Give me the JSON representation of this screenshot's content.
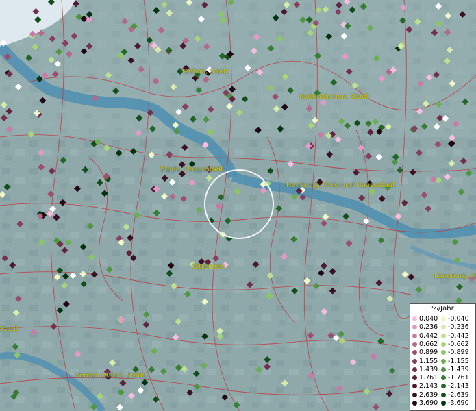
{
  "map": {
    "cities": [
      {
        "name": "Itzehoe, Stadt"
      },
      {
        "name": "Kaltenkirchen, Stadt"
      },
      {
        "name": "Stade, Hansestadt"
      },
      {
        "name": "Hamburg, Freie und Hansestadt"
      },
      {
        "name": "Sittensen"
      },
      {
        "name": "Lüneburg, Hansestadt"
      },
      {
        "name": "Stadt"
      },
      {
        "name": "Verden (Aller), Stadt"
      }
    ],
    "selection_ring": "circle"
  },
  "legend": {
    "title": "%/Jahr",
    "positive_label": [
      "0.040",
      "0.236",
      "0.442",
      "0.662",
      "0.899",
      "1.155",
      "1.439",
      "1.761",
      "2.143",
      "2.639",
      "3.690"
    ],
    "negative_label": [
      "-0.040",
      "-0.236",
      "-0.442",
      "-0.662",
      "-0.899",
      "-1.155",
      "-1.439",
      "-1.761",
      "-2.143",
      "-2.639",
      "-3.690"
    ],
    "positive_colors": [
      "#f7bde0",
      "#e39ac9",
      "#c97aa8",
      "#b06a8a",
      "#9a4f6e",
      "#863f5c",
      "#73304c",
      "#60243c",
      "#4b1a2e",
      "#3a1022",
      "#200812"
    ],
    "negative_colors": [
      "#f0f7c8",
      "#d7ecaa",
      "#bfe090",
      "#a6d57a",
      "#8cc766",
      "#6cae53",
      "#4f9643",
      "#377e35",
      "#236628",
      "#124e1c",
      "#053310"
    ]
  }
}
